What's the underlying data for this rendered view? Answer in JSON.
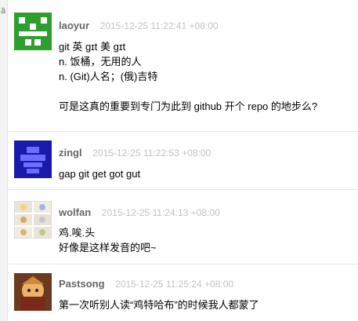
{
  "replies": [
    {
      "username": "laoyur",
      "timestamp": "2015-12-25 11:22:41 +08:00",
      "avatar": "green-pixel-avatar",
      "lines": [
        "git 英 gɪt 美 gɪt",
        "n. 饭桶，无用的人",
        "n. (Git)人名；(俄)吉特"
      ],
      "extra_line": "可是这真的重要到专门为此到 github 开个 repo 的地步么?"
    },
    {
      "username": "zingl",
      "timestamp": "2015-12-25 11:22:53 +08:00",
      "avatar": "blue-pixel-avatar",
      "lines": [
        "gap git get got gut"
      ]
    },
    {
      "username": "wolfan",
      "timestamp": "2015-12-25 11:24:13 +08:00",
      "avatar": "cat-panels-avatar",
      "lines": [
        "鸡.唉.头",
        "好像是这样发音的吧~"
      ]
    },
    {
      "username": "Pastsong",
      "timestamp": "2015-12-25 11:25:24 +08:00",
      "avatar": "anime-character-avatar",
      "lines": [
        "第一次听别人读“鸡特哈布”的时候我人都蒙了"
      ]
    }
  ],
  "colors": {
    "username": "#666666",
    "timestamp": "#c2c2c2",
    "divider": "#e6e6e6",
    "avatar_green": "#2e9e2e",
    "avatar_blue": "#1a1aa8"
  },
  "strip_glyph": "ä"
}
